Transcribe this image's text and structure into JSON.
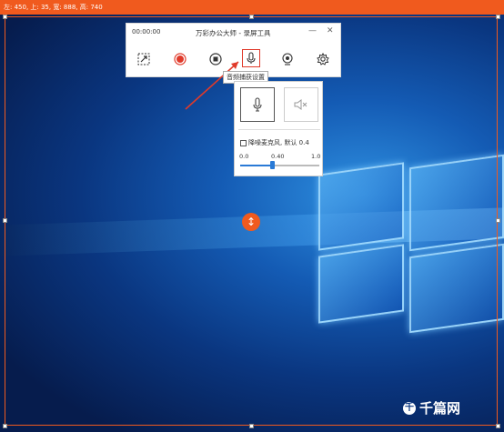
{
  "selection": {
    "info": "左: 450, 上: 35, 宽: 888, 高: 740"
  },
  "recorder": {
    "time": "00:00:00",
    "title": "万彩办公大师 - 录屏工具",
    "minimize": "—",
    "close": "✕",
    "buttons": [
      {
        "name": "region-select-icon"
      },
      {
        "name": "record-icon"
      },
      {
        "name": "stop-icon"
      },
      {
        "name": "microphone-icon"
      },
      {
        "name": "webcam-icon"
      },
      {
        "name": "settings-gear-icon"
      }
    ],
    "tooltip": "音频捕获设置"
  },
  "audio_popup": {
    "noise_label": "降噪麦克风, 默认 0.4",
    "noise_checked": false,
    "scale_min": "0.0",
    "scale_value": "0.40",
    "scale_max": "1.0",
    "slider_value": 0.4
  },
  "watermark": {
    "text": "千篇网"
  },
  "colors": {
    "accent": "#f05a1e",
    "record": "#e03a2a",
    "slider": "#2a7ad6"
  }
}
